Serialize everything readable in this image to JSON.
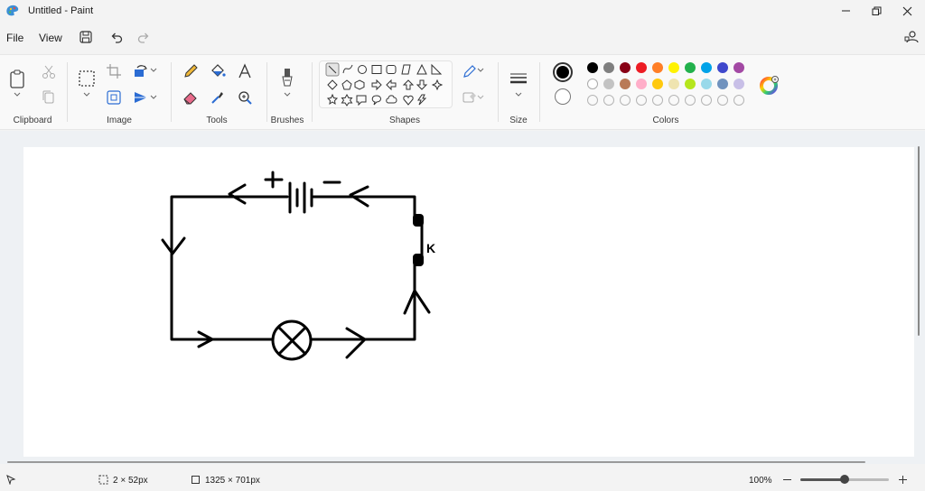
{
  "window": {
    "title": "Untitled - Paint"
  },
  "menu": {
    "file": "File",
    "view": "View"
  },
  "ribbon": {
    "groups": {
      "clipboard": "Clipboard",
      "image": "Image",
      "tools": "Tools",
      "brushes": "Brushes",
      "shapes": "Shapes",
      "size": "Size",
      "colors": "Colors"
    }
  },
  "palette": {
    "primary": "#000000",
    "secondary": "#ffffff",
    "row1": [
      "#000000",
      "#7f7f7f",
      "#880015",
      "#ed1c24",
      "#ff7f27",
      "#fff200",
      "#22b14c",
      "#00a2e8",
      "#3f48cc",
      "#a349a4"
    ],
    "row2": [
      "#ffffff",
      "#c3c3c3",
      "#b97a57",
      "#ffaec9",
      "#ffc90e",
      "#efe4b0",
      "#b5e61d",
      "#99d9ea",
      "#7092be",
      "#c8bfe7"
    ],
    "row3_empty_count": 10
  },
  "canvas": {
    "drawing": "circuit diagram",
    "labels": {
      "plus": "+",
      "minus": "−",
      "switch": "K"
    }
  },
  "status": {
    "selection_size": "2 × 52px",
    "canvas_size": "1325 × 701px",
    "zoom": "100%",
    "zoom_level": 0.5
  }
}
